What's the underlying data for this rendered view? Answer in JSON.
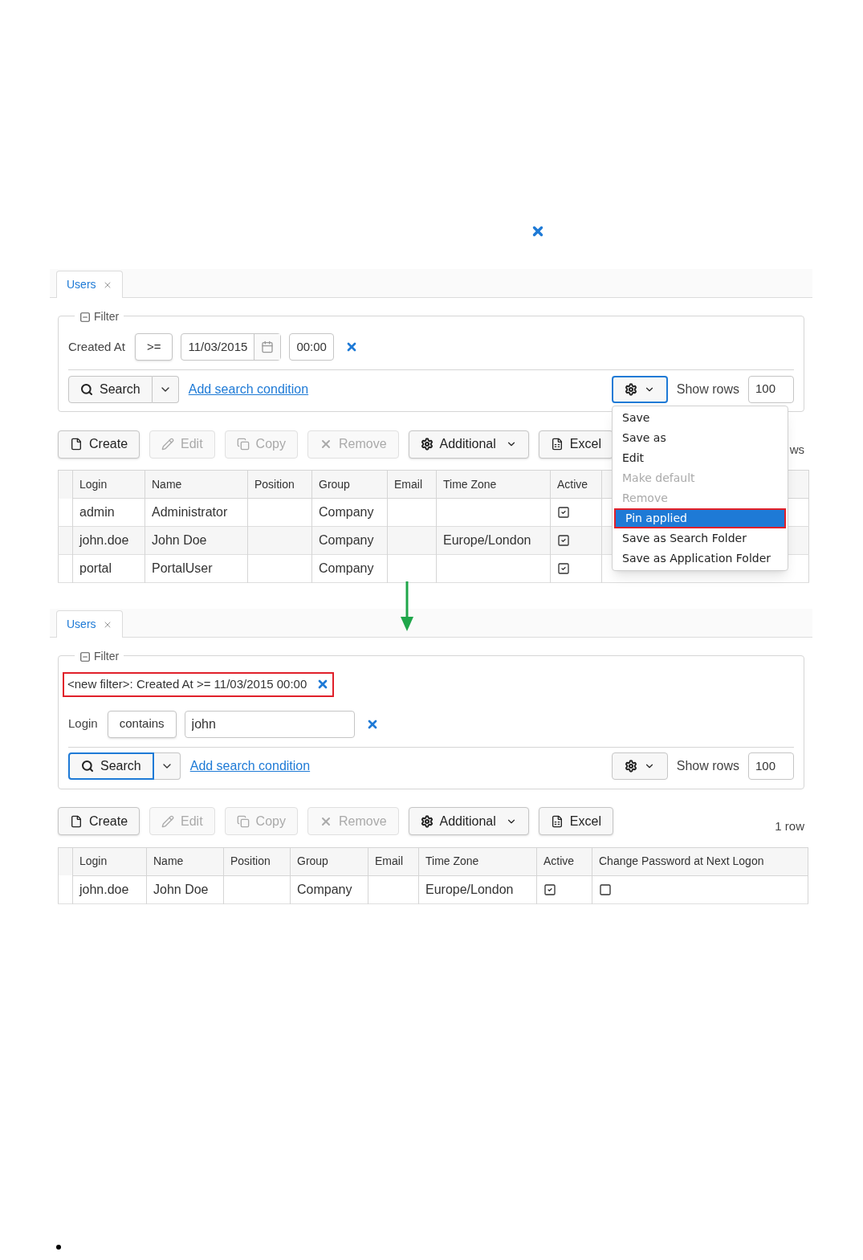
{
  "panels": [
    {
      "tab": {
        "label": "Users",
        "selected": true
      },
      "filter": {
        "legend": "Filter",
        "conditions": [
          {
            "kind": "date",
            "label": "Created At",
            "operator": ">=",
            "date": "11/03/2015",
            "time": "00:00"
          }
        ],
        "search": {
          "label": "Search",
          "focused": false
        },
        "add_condition": "Add search condition",
        "settings": {
          "focused": true
        },
        "show_rows_label": "Show rows",
        "show_rows_value": "100"
      },
      "toolbar": [
        {
          "kind": "create",
          "label": "Create",
          "disabled": false
        },
        {
          "kind": "edit",
          "label": "Edit",
          "disabled": true
        },
        {
          "kind": "copy",
          "label": "Copy",
          "disabled": true
        },
        {
          "kind": "remove",
          "label": "Remove",
          "disabled": true
        },
        {
          "kind": "additional",
          "label": "Additional",
          "disabled": false
        },
        {
          "kind": "excel",
          "label": "Excel",
          "disabled": false
        }
      ],
      "rows_count": "ws",
      "table": {
        "columns": [
          "Login",
          "Name",
          "Position",
          "Group",
          "Email",
          "Time Zone",
          "Active"
        ],
        "rows": [
          {
            "cells": [
              "admin",
              "Administrator",
              "",
              "Company",
              "",
              ""
            ],
            "active": true
          },
          {
            "cells": [
              "john.doe",
              "John Doe",
              "",
              "Company",
              "",
              "Europe/London"
            ],
            "active": true
          },
          {
            "cells": [
              "portal",
              "PortalUser",
              "",
              "Company",
              "",
              ""
            ],
            "active": true
          }
        ]
      },
      "menu": {
        "items": [
          {
            "label": "Save",
            "disabled": false,
            "selected": false
          },
          {
            "label": "Save as",
            "disabled": false,
            "selected": false
          },
          {
            "label": "Edit",
            "disabled": false,
            "selected": false
          },
          {
            "label": "Make default",
            "disabled": true,
            "selected": false
          },
          {
            "label": "Remove",
            "disabled": true,
            "selected": false
          },
          {
            "label": "Pin applied",
            "disabled": false,
            "selected": true
          },
          {
            "label": "Save as Search Folder",
            "disabled": false,
            "selected": false
          },
          {
            "label": "Save as Application Folder",
            "disabled": false,
            "selected": false
          }
        ]
      }
    },
    {
      "tab": {
        "label": "Users",
        "selected": true
      },
      "filter": {
        "legend": "Filter",
        "applied_filter": "<new filter>: Created At >= 11/03/2015 00:00",
        "conditions": [
          {
            "kind": "text",
            "label": "Login",
            "operator": "contains",
            "value": "john"
          }
        ],
        "search": {
          "label": "Search",
          "focused": true
        },
        "add_condition": "Add search condition",
        "settings": {
          "focused": false
        },
        "show_rows_label": "Show rows",
        "show_rows_value": "100"
      },
      "toolbar": [
        {
          "kind": "create",
          "label": "Create",
          "disabled": false
        },
        {
          "kind": "edit",
          "label": "Edit",
          "disabled": true
        },
        {
          "kind": "copy",
          "label": "Copy",
          "disabled": true
        },
        {
          "kind": "remove",
          "label": "Remove",
          "disabled": true
        },
        {
          "kind": "additional",
          "label": "Additional",
          "disabled": false
        },
        {
          "kind": "excel",
          "label": "Excel",
          "disabled": false
        }
      ],
      "rows_count": "1 row",
      "table": {
        "columns": [
          "Login",
          "Name",
          "Position",
          "Group",
          "Email",
          "Time Zone",
          "Active",
          "Change Password at Next Logon"
        ],
        "rows": [
          {
            "cells": [
              "john.doe",
              "John Doe",
              "",
              "Company",
              "",
              "Europe/London"
            ],
            "active": true,
            "change_password": false
          }
        ]
      }
    }
  ]
}
